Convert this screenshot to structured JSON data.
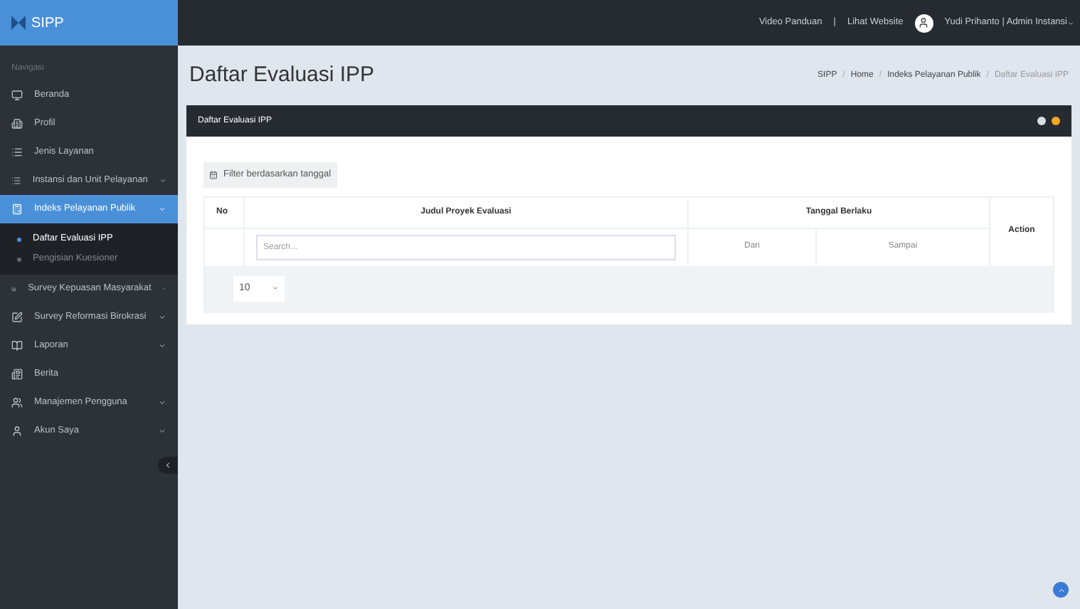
{
  "brand": "SIPP",
  "topbar": {
    "links": [
      "Video Panduan",
      "Lihat Website"
    ],
    "separator": "|",
    "user": "Yudi Prihanto | Admin Instansi"
  },
  "sidebar": {
    "heading": "Navigasi",
    "items": [
      {
        "label": "Beranda",
        "has_arrow": false,
        "selected": false
      },
      {
        "label": "Profil",
        "has_arrow": false,
        "selected": false
      },
      {
        "label": "Jenis Layanan",
        "has_arrow": false,
        "selected": false
      },
      {
        "label": "Instansi dan Unit Pelayanan",
        "has_arrow": true,
        "selected": false
      },
      {
        "label": "Indeks Pelayanan Publik",
        "has_arrow": true,
        "selected": true,
        "children": [
          {
            "label": "Daftar Evaluasi IPP",
            "selected": true
          },
          {
            "label": "Pengisian Kuesioner",
            "selected": false
          }
        ]
      },
      {
        "label": "Survey Kepuasan Masyarakat",
        "has_arrow": true,
        "selected": false
      },
      {
        "label": "Survey Reformasi Birokrasi",
        "has_arrow": true,
        "selected": false
      },
      {
        "label": "Laporan",
        "has_arrow": true,
        "selected": false
      },
      {
        "label": "Berita",
        "has_arrow": false,
        "selected": false
      },
      {
        "label": "Manajemen Pengguna",
        "has_arrow": true,
        "selected": false
      },
      {
        "label": "Akun Saya",
        "has_arrow": true,
        "selected": false
      }
    ]
  },
  "page_title": "Daftar Evaluasi IPP",
  "breadcrumb_separator": "/",
  "breadcrumb": [
    {
      "label": "SIPP",
      "current": false
    },
    {
      "label": "Home",
      "current": false
    },
    {
      "label": "Indeks Pelayanan Publik",
      "current": false
    },
    {
      "label": "Daftar Evaluasi IPP",
      "current": true
    }
  ],
  "panel": {
    "title": "Daftar Evaluasi IPP",
    "filter_button": "Filter berdasarkan tanggal",
    "table": {
      "columns": [
        "No",
        "Judul Proyek Evaluasi",
        "Tanggal Berlaku",
        "Action"
      ],
      "search_placeholder": "Search...",
      "date_from": "Dari",
      "date_to": "Sampai"
    },
    "page_size": "10"
  }
}
